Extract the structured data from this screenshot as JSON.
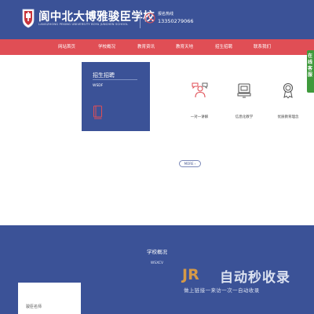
{
  "header": {
    "title": "阆中北大博雅骏臣学校",
    "subtitle": "LANGZHONG PEKING UNIVERSITY BOYA JUNCHEN SCHOOL",
    "phone_label": "报名热线",
    "phone_number": "13350279066",
    "background_color": "#3b5297"
  },
  "nav": {
    "background_color": "#e04e55",
    "items": [
      {
        "label": "网站首页"
      },
      {
        "label": "学校概况"
      },
      {
        "label": "教育资讯"
      },
      {
        "label": "教育天地"
      },
      {
        "label": "招生招聘"
      },
      {
        "label": "联系我们"
      }
    ]
  },
  "side_float": {
    "text": "在线客服"
  },
  "admissions": {
    "title": "招生招聘",
    "subtitle": "WSDF",
    "icon": "book-icon"
  },
  "features": [
    {
      "label": "一对一讲解",
      "icon": "tutoring-icon"
    },
    {
      "label": "信息化教学",
      "icon": "computer-icon"
    },
    {
      "label": "优质教育理念",
      "icon": "award-icon"
    }
  ],
  "more_button": "MORE",
  "bottom": {
    "title": "学校概况",
    "subtitle": "WSXCV",
    "card_label": "骏臣名师"
  },
  "watermark": {
    "logo": "JR",
    "main": "自动秒收录",
    "sub": "做上链接一来访一次一自动收录"
  }
}
